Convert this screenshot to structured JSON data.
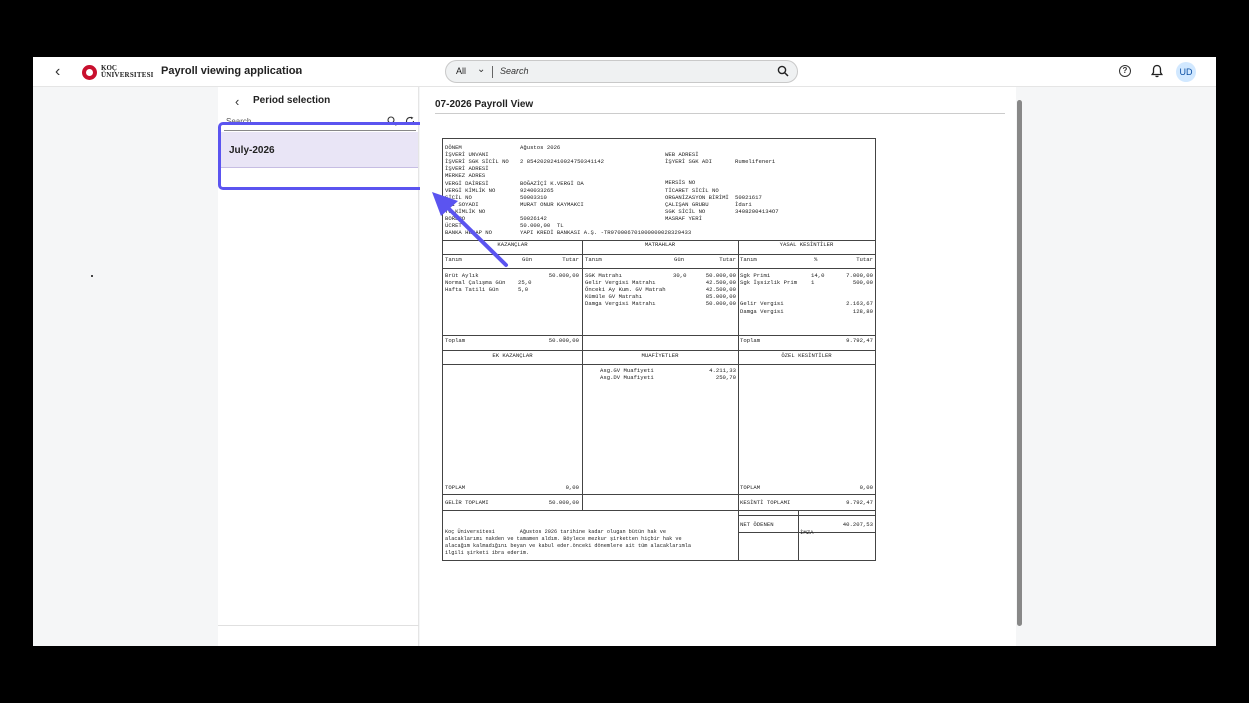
{
  "shell": {
    "app_title": "Payroll viewing application",
    "logo_line1": "KOÇ",
    "logo_line2": "ÜNIVERSITESI",
    "search_scope": "All",
    "search_placeholder": "Search",
    "avatar_initials": "UD"
  },
  "period": {
    "title": "Period selection",
    "search_placeholder": "Search",
    "items": [
      {
        "label": "July-2026"
      }
    ]
  },
  "main": {
    "title": "07-2026 Payroll View"
  },
  "doc": {
    "header_left": [
      [
        "DÖNEM",
        "Ağustos 2026"
      ],
      [
        "İŞVERİ UNVANI",
        ""
      ],
      [
        "İŞVERİ SGK SİCİL NO",
        "2 85420202410024750341142"
      ],
      [
        "İŞVERİ ADRESİ",
        ""
      ],
      [
        "MERKEZ ADRES",
        ""
      ],
      [
        "VERGİ DAİRESİ",
        "BOĞAZİÇİ K.VERGİ DA"
      ],
      [
        "VERGİ KİMLİK NO",
        "9240033265"
      ],
      [
        "SİCİL NO",
        "50003310"
      ],
      [
        "ADI SOYADI",
        "MURAT ONUR KAYMAKCI"
      ],
      [
        "TC KİMLİK NO",
        ""
      ],
      [
        "BORDRO",
        "50026142"
      ],
      [
        "ÜCRET",
        "50.000,00  TL"
      ],
      [
        "BANKA HESAP NO",
        "YAPI KREDİ BANKASI A.Ş. -TR970006701000000028329433"
      ]
    ],
    "header_right": [
      [
        "WEB ADRESİ",
        ""
      ],
      [
        "İŞYERİ SGK ADI",
        "Rumelifeneri"
      ],
      [
        "",
        ""
      ],
      [
        "",
        ""
      ],
      [
        "MERSİS NO",
        ""
      ],
      [
        "TİCARET SİCİL NO",
        ""
      ],
      [
        "ORGANİZASYON BİRİMİ",
        "50021617"
      ],
      [
        "ÇALIŞAN GRUBU",
        "İdari"
      ],
      [
        "SGK SİCİL NO",
        "34082004134O7"
      ],
      [
        "MASRAF YERİ",
        ""
      ]
    ],
    "sec_kazanclar": "KAZANÇLAR",
    "sec_matrahlar": "MATRAHLAR",
    "sec_yasal": "YASAL KESİNTİLER",
    "col_tanim": "Tanım",
    "col_gun": "Gün",
    "col_tutar": "Tutar",
    "col_pct": "%",
    "kazanc_rows": [
      [
        "Brüt Aylık",
        "",
        "50.000,00"
      ],
      [
        "Normal Çalışma Gün",
        "25,0",
        ""
      ],
      [
        "Hafta Tatili Gün",
        "5,0",
        ""
      ]
    ],
    "matrah_rows": [
      [
        "SGK Matrahı",
        "30,0",
        "50.000,00"
      ],
      [
        "Gelir Vergisi Matrahı",
        "",
        "42.500,00"
      ],
      [
        "Önceki Ay Kum. GV Matrah",
        "",
        "42.500,00"
      ],
      [
        "Kümüle GV Matrahı",
        "",
        "85.000,00"
      ],
      [
        "Damga Vergisi Matrahı",
        "",
        "50.000,00"
      ]
    ],
    "yasal_rows": [
      [
        "Sgk Primi",
        "14,0",
        "7.000,00"
      ],
      [
        "Sgk İşsizlik Prim",
        "1",
        "500,00"
      ],
      [
        "",
        "",
        ""
      ],
      [
        "",
        "",
        ""
      ],
      [
        "Gelir Vergisi",
        "",
        "2.163,67"
      ],
      [
        "Damga Vergisi",
        "",
        "128,80"
      ]
    ],
    "toplam_label": "Toplam",
    "toplam_kazanc": "50.000,00",
    "toplam_yasal": "9.792,47",
    "sec_ek": "EK KAZANÇLAR",
    "sec_muafiyet": "MUAFİYETLER",
    "sec_ozel": "ÖZEL KESİNTİLER",
    "muafiyet_rows": [
      [
        "Asg.GV Muafiyeti",
        "4.211,33"
      ],
      [
        "Asg.DV Muafiyeti",
        "250,70"
      ]
    ],
    "toplam2_label": "TOPLAM",
    "toplam_ek": "0,00",
    "toplam_ozel": "0,00",
    "gelir_toplami_label": "GELİR TOPLAMI",
    "gelir_toplami": "50.000,00",
    "kesinti_toplami_label": "KESİNTİ TOPLAMI",
    "kesinti_toplami": "9.792,47",
    "net_odenen_label": "NET ÖDENEN",
    "net_odenen": "40.207,53",
    "imza_label": "İMZA",
    "footer_lines": [
      "Koç Üniversitesi        Ağustos 2026 tarihine kadar olugan bütün hak ve",
      "alacaklarımı nakden ve tamamen aldım. Böylece mezkur şirketten hiçbir hak ve",
      "alacağım kalmadığını beyan ve kabul eder.önceki dönemlere ait tüm alacaklarımla",
      "ilgili şirketi ibra ederim."
    ]
  },
  "colors": {
    "accent": "#5b54f0",
    "selected_bg": "#e9e5f6",
    "brand": "#c8102e"
  }
}
